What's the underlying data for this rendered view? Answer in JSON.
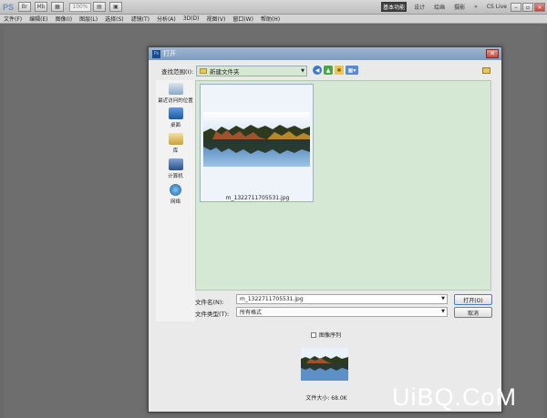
{
  "app": {
    "logo": "PS",
    "zoom": "100%",
    "workspaces": [
      "基本功能",
      "设计",
      "绘画",
      "摄影"
    ],
    "cs_live": "CS Live"
  },
  "menu": [
    "文件(F)",
    "编辑(E)",
    "图像(I)",
    "图层(L)",
    "选择(S)",
    "滤镜(T)",
    "分析(A)",
    "3D(D)",
    "视图(V)",
    "窗口(W)",
    "帮助(H)"
  ],
  "dialog": {
    "title": "打开",
    "look_in_label": "查找范围(I):",
    "look_in_value": "新建文件夹",
    "places": [
      "最近访问的位置",
      "桌面",
      "库",
      "计算机",
      "网络"
    ],
    "files": [
      {
        "name": "m_1322711705531.jpg"
      }
    ],
    "file_name_label": "文件名(N):",
    "file_name_value": "m_1322711705531.jpg",
    "file_type_label": "文件类型(T):",
    "file_type_value": "所有格式",
    "open_button": "打开(O)",
    "cancel_button": "取消",
    "image_sequence": "图像序列",
    "file_size": "文件大小: 68.0K"
  },
  "watermark": "UiBQ.CoM",
  "colors": {
    "file_list_bg": "#d4e8d3",
    "title_bar": "#8ba6c8"
  }
}
